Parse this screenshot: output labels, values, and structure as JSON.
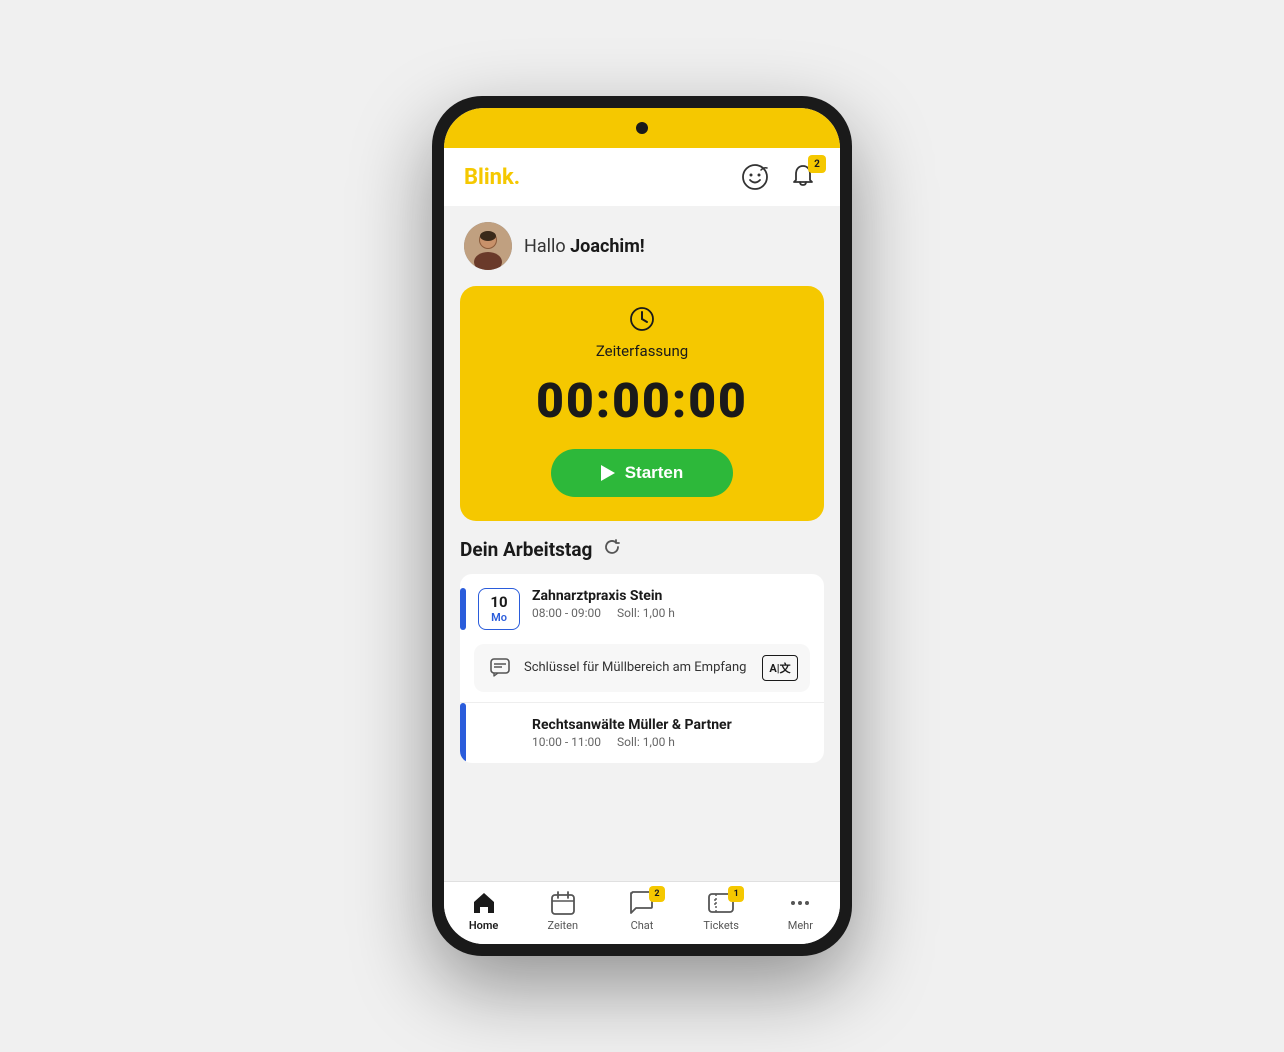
{
  "app": {
    "logo": "Blink",
    "logo_dot": "."
  },
  "header": {
    "notification_badge": "2",
    "emoji_icon_label": "emoji-icon",
    "bell_icon_label": "bell-icon"
  },
  "greeting": {
    "prefix": "Hallo ",
    "name": "Joachim!",
    "avatar_alt": "Joachim avatar"
  },
  "time_tracking": {
    "label": "Zeiterfassung",
    "time_display": "00:00:00",
    "start_button_label": "Starten",
    "icon_label": "clock-icon"
  },
  "workday": {
    "title": "Dein Arbeitstag",
    "refresh_label": "refresh-icon",
    "shifts": [
      {
        "date_day": "10",
        "date_weekday": "Mo",
        "name": "Zahnarztpraxis Stein",
        "time": "08:00 - 09:00",
        "soll": "Soll: 1,00 h",
        "message": "Schlüssel für Müllbereich am Empfang",
        "has_translate": true
      },
      {
        "date_day": "",
        "date_weekday": "",
        "name": "Rechtsanwälte Müller & Partner",
        "time": "10:00 - 11:00",
        "soll": "Soll: 1,00 h",
        "has_translate": false
      }
    ]
  },
  "bottom_nav": {
    "items": [
      {
        "id": "home",
        "label": "Home",
        "active": true,
        "badge": null
      },
      {
        "id": "zeiten",
        "label": "Zeiten",
        "active": false,
        "badge": null
      },
      {
        "id": "chat",
        "label": "Chat",
        "active": false,
        "badge": "2"
      },
      {
        "id": "tickets",
        "label": "Tickets",
        "active": false,
        "badge": "1"
      },
      {
        "id": "mehr",
        "label": "Mehr",
        "active": false,
        "badge": null
      }
    ]
  }
}
